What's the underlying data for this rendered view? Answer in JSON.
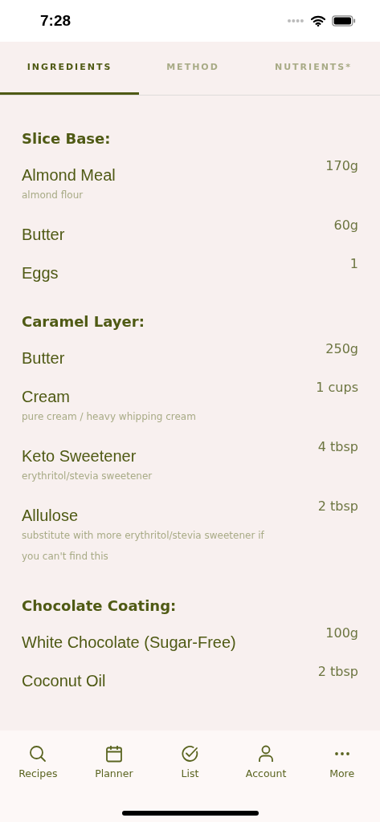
{
  "status_bar": {
    "time": "7:28"
  },
  "tabs": [
    {
      "label": "INGREDIENTS",
      "selected": true
    },
    {
      "label": "METHOD",
      "selected": false
    },
    {
      "label": "NUTRIENTS*",
      "selected": false
    }
  ],
  "sections": [
    {
      "title": "Slice Base:",
      "items": [
        {
          "name": "Almond Meal",
          "amount": "170g",
          "note": "almond flour"
        },
        {
          "name": "Butter",
          "amount": "60g"
        },
        {
          "name": "Eggs",
          "amount": "1"
        }
      ]
    },
    {
      "title": "Caramel Layer:",
      "items": [
        {
          "name": "Butter",
          "amount": "250g"
        },
        {
          "name": "Cream",
          "amount": "1 cups",
          "note": "pure cream / heavy whipping cream"
        },
        {
          "name": "Keto Sweetener",
          "amount": "4 tbsp",
          "note": "erythritol/stevia sweetener"
        },
        {
          "name": "Allulose",
          "amount": "2 tbsp",
          "note": "substitute with more erythritol/stevia sweetener if you can't find this"
        }
      ]
    },
    {
      "title": "Chocolate Coating:",
      "items": [
        {
          "name": "White Chocolate (Sugar-Free)",
          "amount": "100g"
        },
        {
          "name": "Coconut Oil",
          "amount": "2 tbsp"
        }
      ]
    }
  ],
  "bottom_nav": [
    {
      "kind": "search",
      "label": "Recipes"
    },
    {
      "kind": "calendar",
      "label": "Planner"
    },
    {
      "kind": "check",
      "label": "List"
    },
    {
      "kind": "person",
      "label": "Account"
    },
    {
      "kind": "more",
      "label": "More"
    }
  ]
}
